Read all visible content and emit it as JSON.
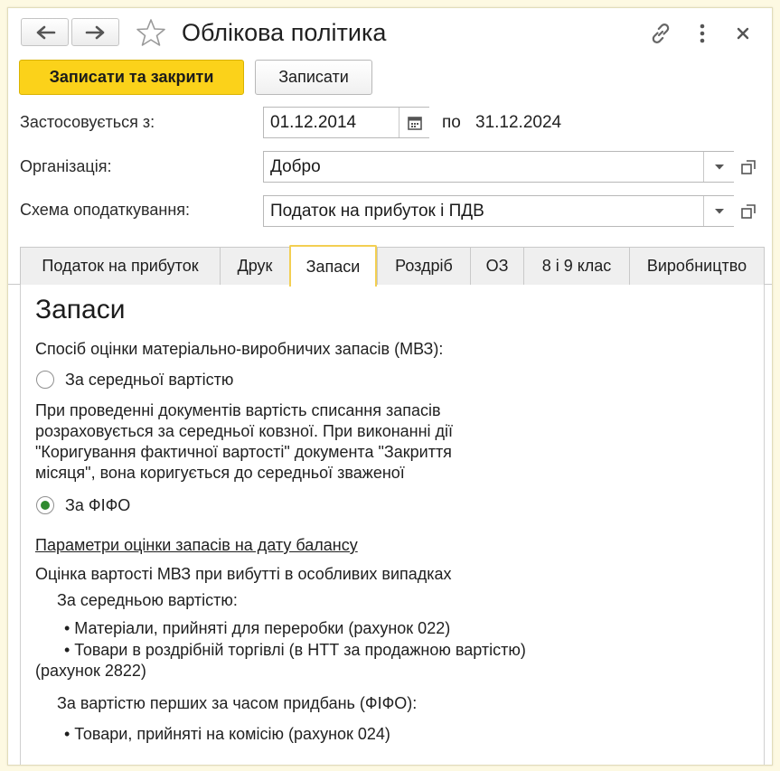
{
  "window": {
    "title": "Облікова політика"
  },
  "toolbar": {
    "save_close_label": "Записати та закрити",
    "save_label": "Записати"
  },
  "form": {
    "applies_from_label": "Застосовується з:",
    "applies_from_value": "01.12.2014",
    "to_label": "по",
    "to_value": "31.12.2024",
    "organization_label": "Організація:",
    "organization_value": "Добро",
    "tax_scheme_label": "Схема оподаткування:",
    "tax_scheme_value": "Податок на прибуток і ПДВ"
  },
  "tabs": [
    {
      "label": "Податок на прибуток",
      "active": false
    },
    {
      "label": "Друк",
      "active": false
    },
    {
      "label": "Запаси",
      "active": true
    },
    {
      "label": "Роздріб",
      "active": false
    },
    {
      "label": "ОЗ",
      "active": false
    },
    {
      "label": "8 і 9 клас",
      "active": false
    },
    {
      "label": "Виробництво",
      "active": false
    }
  ],
  "inventory": {
    "heading": "Запаси",
    "method_label": "Спосіб оцінки матеріально-виробничих запасів (МВЗ):",
    "option_average": {
      "label": "За середньої вартістю",
      "selected": false,
      "description": [
        "При проведенні документів вартість списання запасів",
        "розраховується за середньої ковзної. При виконанні дії",
        "\"Коригування фактичної вартості\" документа \"Закриття",
        "місяця\", вона коригується до середньої зваженої"
      ]
    },
    "option_fifo": {
      "label": "За ФІФО",
      "selected": true
    },
    "balance_params_link": "Параметри оцінки запасів на дату балансу",
    "special_cases_label": "Оцінка вартості МВЗ при вибутті в особливих випадках",
    "average_group_label": "За середньою вартістю:",
    "average_items": [
      "• Матеріали, прийняті для переробки (рахунок 022)",
      "• Товари в роздрібній торгівлі (в НТТ за продажною вартістю)"
    ],
    "average_items_continuation": "(рахунок 2822)",
    "fifo_group_label": "За вартістю перших за часом придбань (ФІФО):",
    "fifo_items": [
      "• Товари, прийняті на комісію (рахунок 024)"
    ]
  }
}
